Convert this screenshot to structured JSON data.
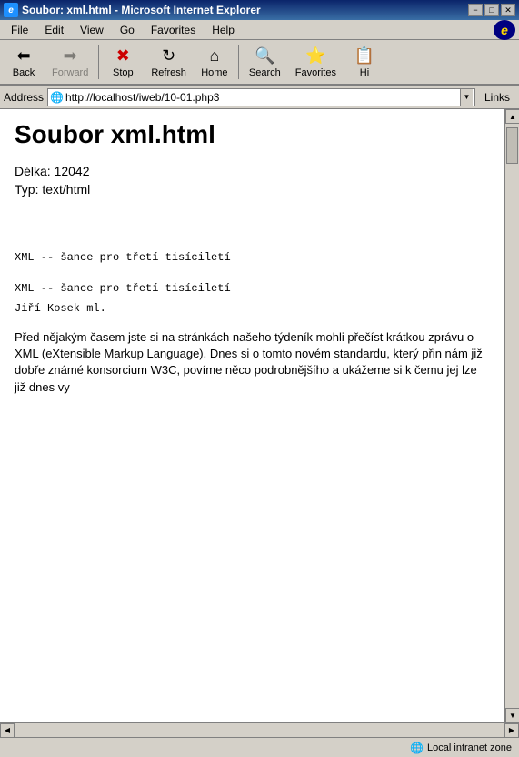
{
  "titlebar": {
    "title": "Soubor: xml.html - Microsoft Internet Explorer",
    "minimize": "−",
    "maximize": "□",
    "close": "✕"
  },
  "menubar": {
    "items": [
      "File",
      "Edit",
      "View",
      "Go",
      "Favorites",
      "Help"
    ]
  },
  "toolbar": {
    "buttons": [
      {
        "id": "back",
        "label": "Back",
        "icon": "←",
        "disabled": false,
        "has_dropdown": true
      },
      {
        "id": "forward",
        "label": "Forward",
        "icon": "→",
        "disabled": true,
        "has_dropdown": true
      },
      {
        "id": "stop",
        "label": "Stop",
        "icon": "✕"
      },
      {
        "id": "refresh",
        "label": "Refresh",
        "icon": "↻"
      },
      {
        "id": "home",
        "label": "Home",
        "icon": "⌂"
      },
      {
        "id": "search",
        "label": "Search",
        "icon": "🔍"
      },
      {
        "id": "favorites",
        "label": "Favorites",
        "icon": "⭐"
      },
      {
        "id": "history",
        "label": "Hi",
        "icon": "📋"
      }
    ]
  },
  "addressbar": {
    "label": "Address",
    "url": "http://localhost/iweb/10-01.php3",
    "links_label": "Links"
  },
  "page": {
    "heading": "Soubor xml.html",
    "meta_delka": "Délka: 12042",
    "meta_typ": "Typ: text/html",
    "pretext1": "XML -- šance pro třetí tisíciletí",
    "pretext2": "XML -- šance pro třetí tisíciletí",
    "author": "Jiří Kosek ml.",
    "bodytext": "Před nějakým časem jste si na stránkách našeho týdeník mohli přečíst krátkou zprávu o XML (eXtensible Markup Language). Dnes si o tomto novém standardu, který přin nám již dobře známé konsorcium W3C, povíme něco podrobnějšího a ukážeme si k čemu jej lze již dnes vy"
  },
  "statusbar": {
    "left": "",
    "zone": "Local intranet zone",
    "zone_icon": "🌐"
  }
}
